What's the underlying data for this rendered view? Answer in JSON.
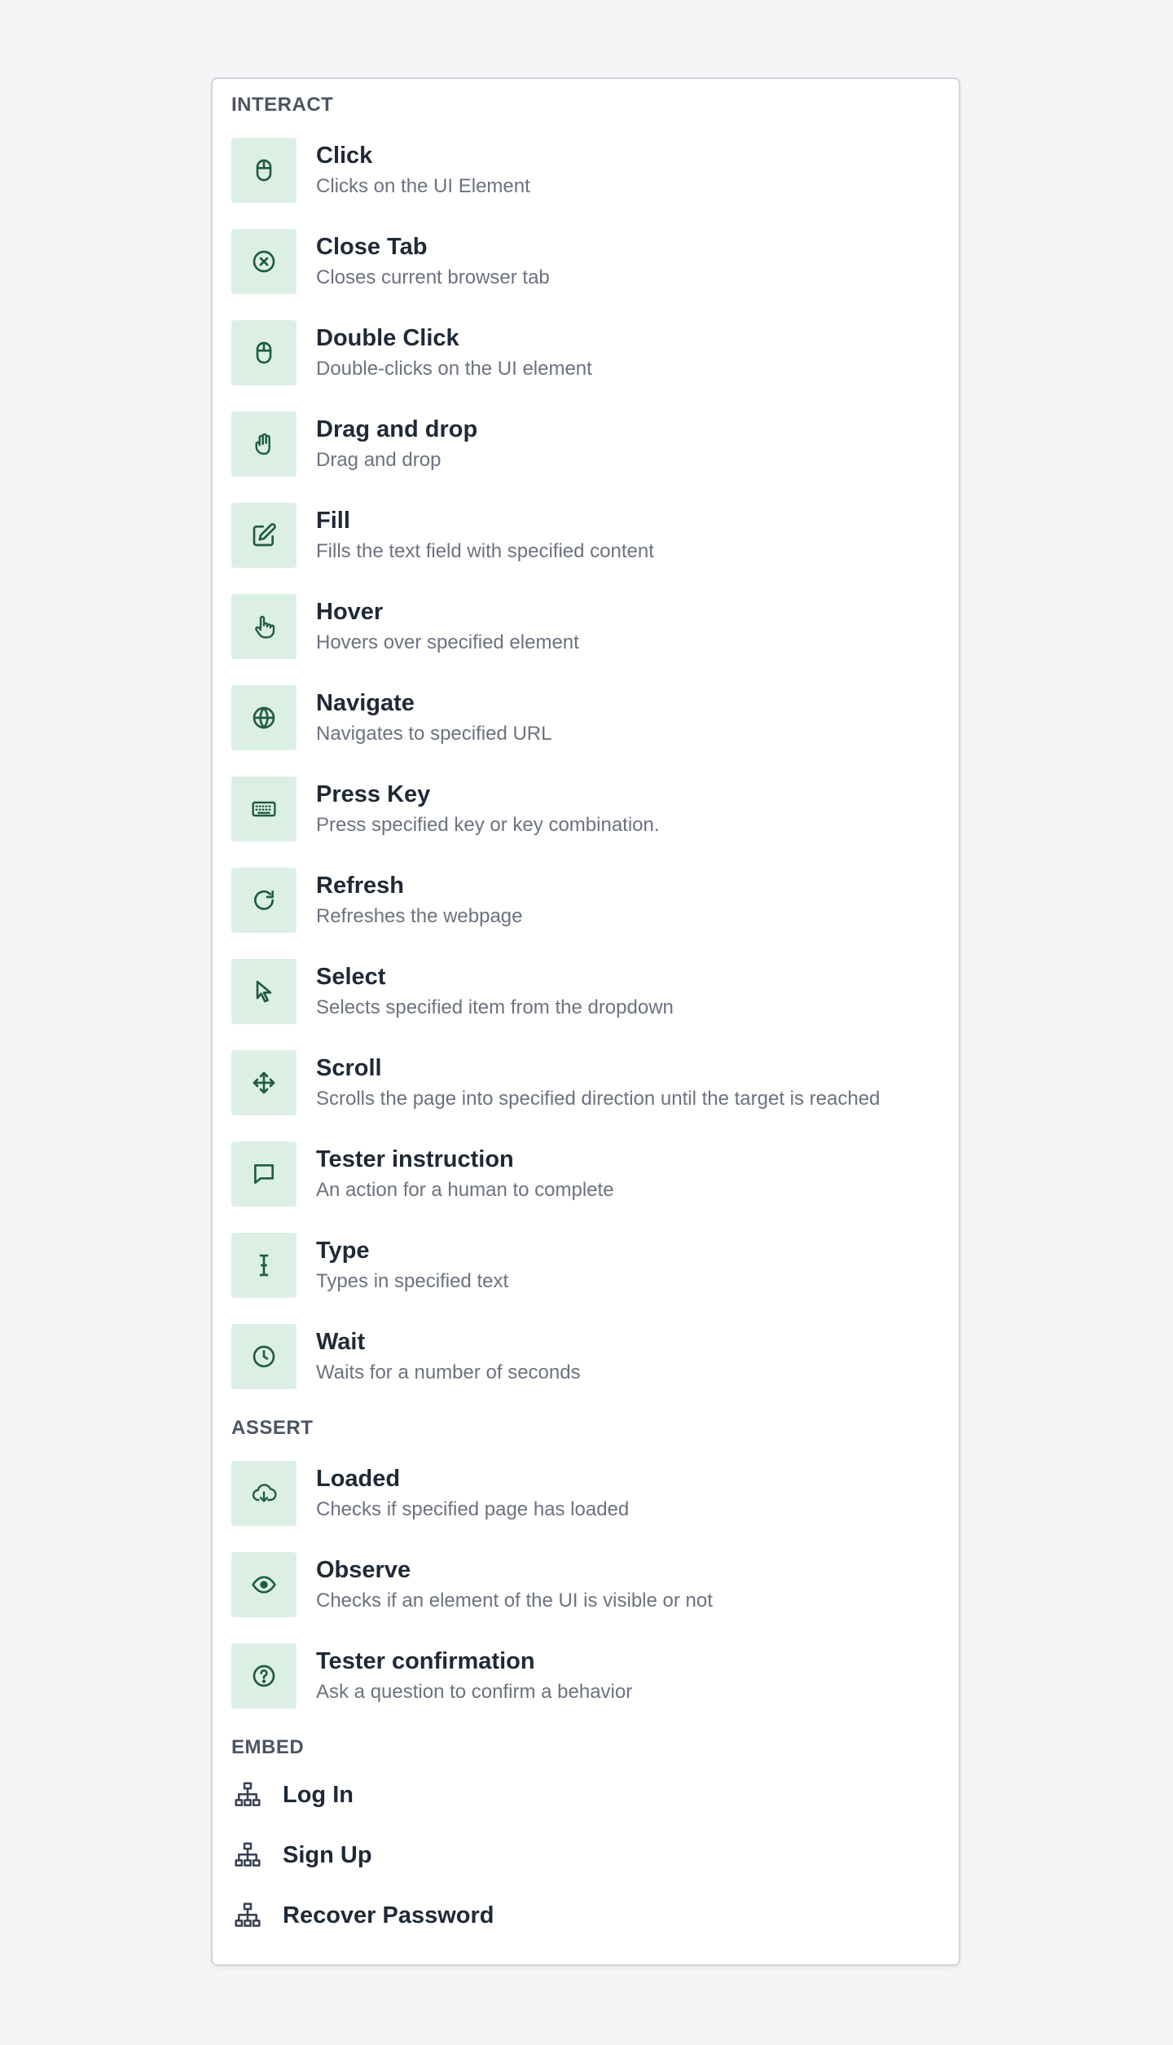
{
  "interact": {
    "heading": "INTERACT",
    "items": [
      {
        "title": "Click",
        "desc": "Clicks on the UI Element",
        "icon": "mouse-icon"
      },
      {
        "title": "Close Tab",
        "desc": "Closes current browser tab",
        "icon": "close-circle-icon"
      },
      {
        "title": "Double Click",
        "desc": "Double-clicks on the UI element",
        "icon": "mouse-icon"
      },
      {
        "title": "Drag and drop",
        "desc": "Drag and drop",
        "icon": "hand-icon"
      },
      {
        "title": "Fill",
        "desc": "Fills the text field with specified content",
        "icon": "edit-icon"
      },
      {
        "title": "Hover",
        "desc": "Hovers over specified element",
        "icon": "pointer-hand-icon"
      },
      {
        "title": "Navigate",
        "desc": "Navigates to specified URL",
        "icon": "globe-icon"
      },
      {
        "title": "Press Key",
        "desc": "Press specified key or key combination.",
        "icon": "keyboard-icon"
      },
      {
        "title": "Refresh",
        "desc": "Refreshes the webpage",
        "icon": "refresh-icon"
      },
      {
        "title": "Select",
        "desc": "Selects specified item from the dropdown",
        "icon": "cursor-icon"
      },
      {
        "title": "Scroll",
        "desc": "Scrolls the page into specified direction until the target is reached",
        "icon": "move-icon"
      },
      {
        "title": "Tester instruction",
        "desc": "An action for a human to complete",
        "icon": "chat-icon"
      },
      {
        "title": "Type",
        "desc": "Types in specified text",
        "icon": "text-cursor-icon"
      },
      {
        "title": "Wait",
        "desc": "Waits for a number of seconds",
        "icon": "clock-icon"
      }
    ]
  },
  "assert": {
    "heading": "ASSERT",
    "items": [
      {
        "title": "Loaded",
        "desc": "Checks if specified page has loaded",
        "icon": "cloud-download-icon"
      },
      {
        "title": "Observe",
        "desc": "Checks if an element of the UI is visible or not",
        "icon": "eye-icon"
      },
      {
        "title": "Tester confirmation",
        "desc": "Ask a question to confirm a behavior",
        "icon": "question-circle-icon"
      }
    ]
  },
  "embed": {
    "heading": "EMBED",
    "items": [
      {
        "label": "Log In",
        "icon": "sitemap-icon"
      },
      {
        "label": "Sign Up",
        "icon": "sitemap-icon"
      },
      {
        "label": "Recover Password",
        "icon": "sitemap-icon"
      }
    ]
  },
  "colors": {
    "icon_bg": "#dcefe5",
    "icon_fg": "#1f5c42",
    "title": "#1f2937",
    "desc": "#6b7280",
    "heading": "#4b5563"
  }
}
